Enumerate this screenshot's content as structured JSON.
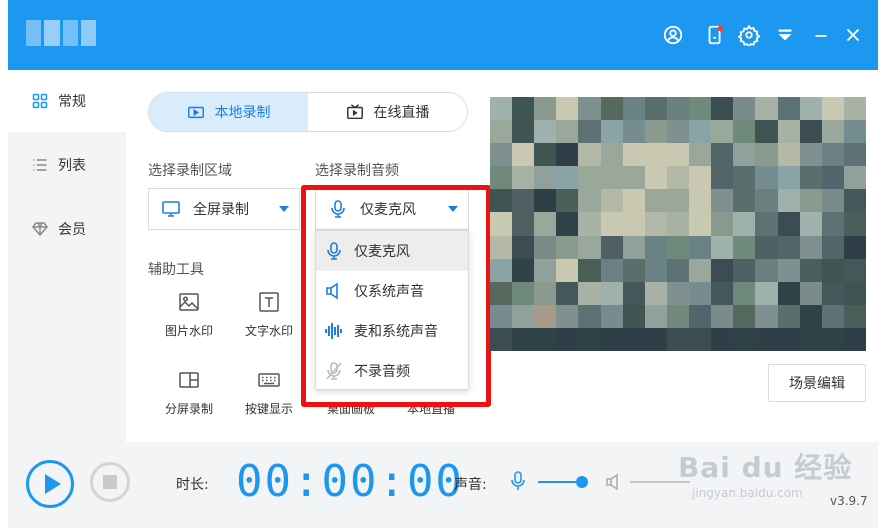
{
  "app": {
    "version": "v3.9.7"
  },
  "sidebar": {
    "items": [
      {
        "label": "常规",
        "icon": "grid-icon",
        "active": true
      },
      {
        "label": "列表",
        "icon": "list-icon",
        "active": false
      },
      {
        "label": "会员",
        "icon": "diamond-icon",
        "active": false
      }
    ]
  },
  "mode_tabs": [
    {
      "label": "本地录制",
      "icon": "video-icon",
      "active": true
    },
    {
      "label": "在线直播",
      "icon": "tv-icon",
      "active": false
    }
  ],
  "record_area": {
    "label": "选择录制区域",
    "value": "全屏录制",
    "icon": "monitor-icon"
  },
  "record_audio": {
    "label": "选择录制音频",
    "value": "仅麦克风",
    "icon": "mic-icon",
    "options": [
      {
        "label": "仅麦克风",
        "icon": "mic-icon",
        "selected": true
      },
      {
        "label": "仅系统声音",
        "icon": "speaker-icon",
        "selected": false
      },
      {
        "label": "麦和系统声音",
        "icon": "sound-wave-icon",
        "selected": false
      },
      {
        "label": "不录音频",
        "icon": "mic-off-icon",
        "selected": false
      }
    ]
  },
  "tools": {
    "label": "辅助工具",
    "items": [
      {
        "label": "图片水印",
        "icon": "image-icon"
      },
      {
        "label": "文字水印",
        "icon": "text-icon"
      },
      {
        "label": "分屏录制",
        "icon": "split-screen-icon"
      },
      {
        "label": "按键显示",
        "icon": "keyboard-icon"
      },
      {
        "label": "桌面画板",
        "icon": "board-icon"
      },
      {
        "label": "本地直播",
        "icon": "live-icon"
      }
    ]
  },
  "preview": {
    "scene_button": "场景编辑"
  },
  "bottom": {
    "duration_label": "时长:",
    "timer": "00:00:00",
    "volume_label": "声音:",
    "mic_volume": 0.85
  },
  "watermark": {
    "text": "Bai du 经验",
    "sub": "jingyan.baidu.com"
  },
  "colors": {
    "accent": "#1d98f0",
    "highlight": "#ee1111"
  }
}
